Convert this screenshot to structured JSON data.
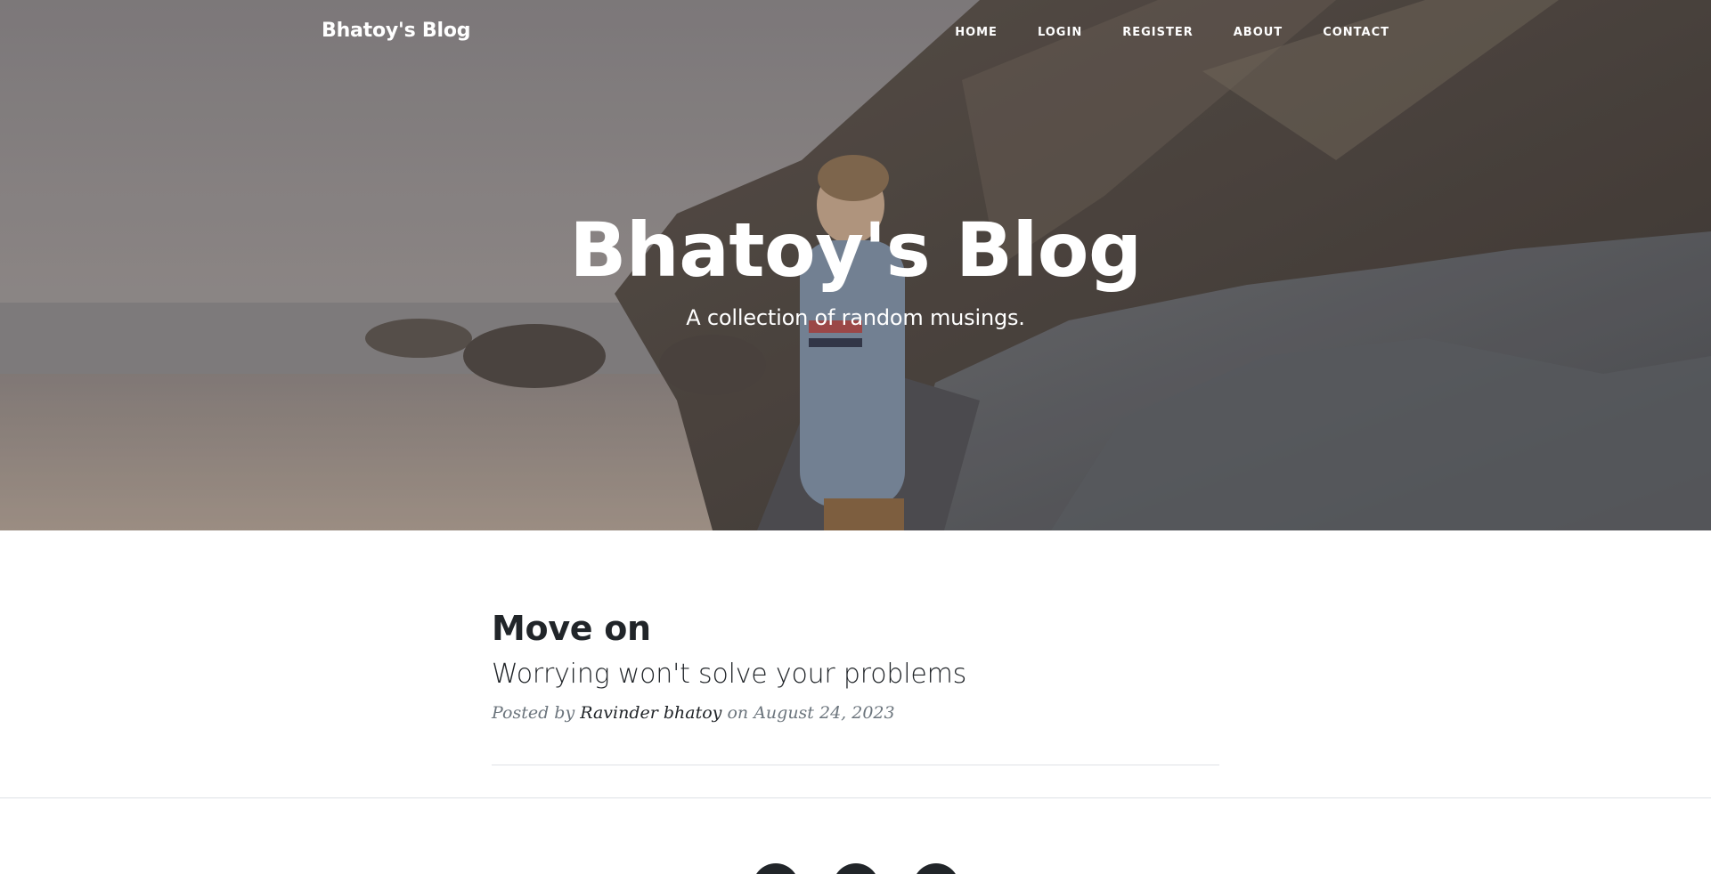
{
  "nav": {
    "brand": "Bhatoy's Blog",
    "links": [
      {
        "label": "HOME"
      },
      {
        "label": "LOGIN"
      },
      {
        "label": "REGISTER"
      },
      {
        "label": "ABOUT"
      },
      {
        "label": "CONTACT"
      }
    ]
  },
  "hero": {
    "title": "Bhatoy's Blog",
    "subtitle": "A collection of random musings."
  },
  "posts": [
    {
      "title": "Move on",
      "subtitle": "Worrying won't solve your problems",
      "meta_prefix": "Posted by",
      "author": "Ravinder bhatoy",
      "meta_on": "on",
      "date": "August 24, 2023"
    }
  ],
  "footer": {
    "social_icons": [
      "twitter-icon",
      "facebook-icon",
      "github-icon"
    ]
  },
  "colors": {
    "text_dark": "#212529",
    "text_muted": "#6c757d",
    "divider": "#dee2e6",
    "nav_text": "#ffffff"
  }
}
